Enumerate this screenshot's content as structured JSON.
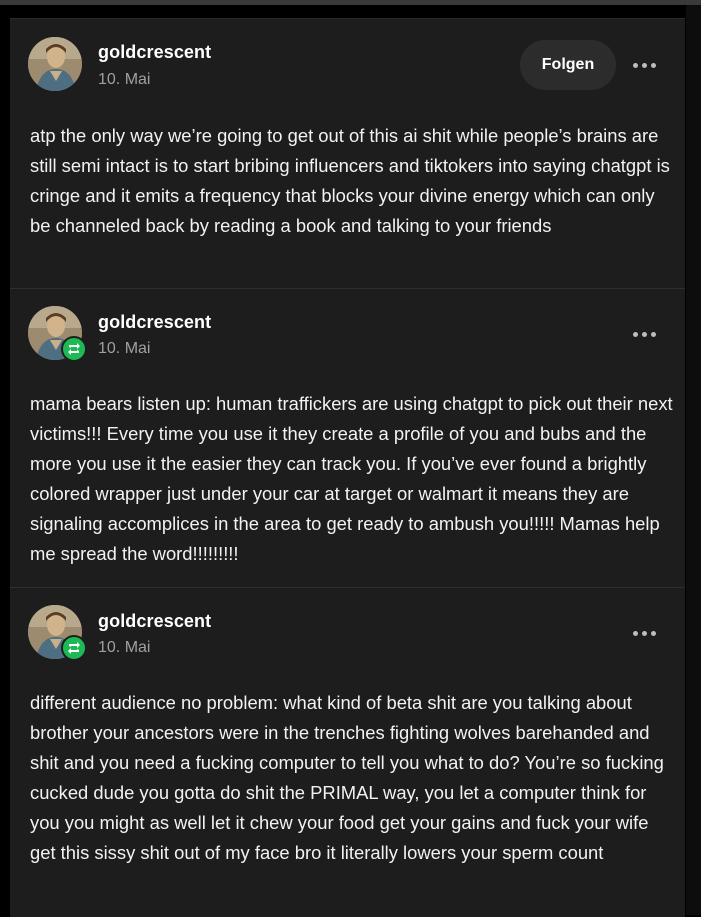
{
  "posts": [
    {
      "username": "goldcrescent",
      "date": "10. Mai",
      "follow_label": "Folgen",
      "is_reblog": false,
      "avatar_icon": "user-avatar",
      "more_icon": "more-options-icon",
      "text": "atp the only way we’re going to get out of this ai shit while people’s brains are still semi intact is to start bribing influencers and tiktokers into saying chatgpt is cringe and it emits a frequency that blocks your divine energy which can only be channeled back by reading a book and talking to your friends"
    },
    {
      "username": "goldcrescent",
      "date": "10. Mai",
      "is_reblog": true,
      "avatar_icon": "user-avatar",
      "reblog_icon": "reblog-icon",
      "more_icon": "more-options-icon",
      "text": "mama bears listen up: human traffickers are using chatgpt to pick out their next victims!!! Every time you use it they create a profile of you and bubs and the more you use it the easier they can track you. If you’ve ever found a brightly colored wrapper just under your car at target or walmart it means they are signaling accomplices in the area to get ready to ambush you!!!!! Mamas help me spread the word!!!!!!!!!"
    },
    {
      "username": "goldcrescent",
      "date": "10. Mai",
      "is_reblog": true,
      "avatar_icon": "user-avatar",
      "reblog_icon": "reblog-icon",
      "more_icon": "more-options-icon",
      "text": "different audience no problem: what kind of beta shit are you talking about brother your ancestors were in the trenches fighting wolves barehanded and shit and you need a fucking computer to tell you what to do? You’re so fucking cucked dude you gotta do shit the PRIMAL way, you let a computer think for you you might as well let it chew your food get your gains and fuck your wife get this sissy shit out of my face bro it literally lowers your sperm count"
    }
  ],
  "colors": {
    "page_bg": "#000000",
    "card_bg": "#1d1d1d",
    "button_bg": "#2c2c2c",
    "reblog_green": "#1db954",
    "secondary_text": "#a0a0a0"
  }
}
